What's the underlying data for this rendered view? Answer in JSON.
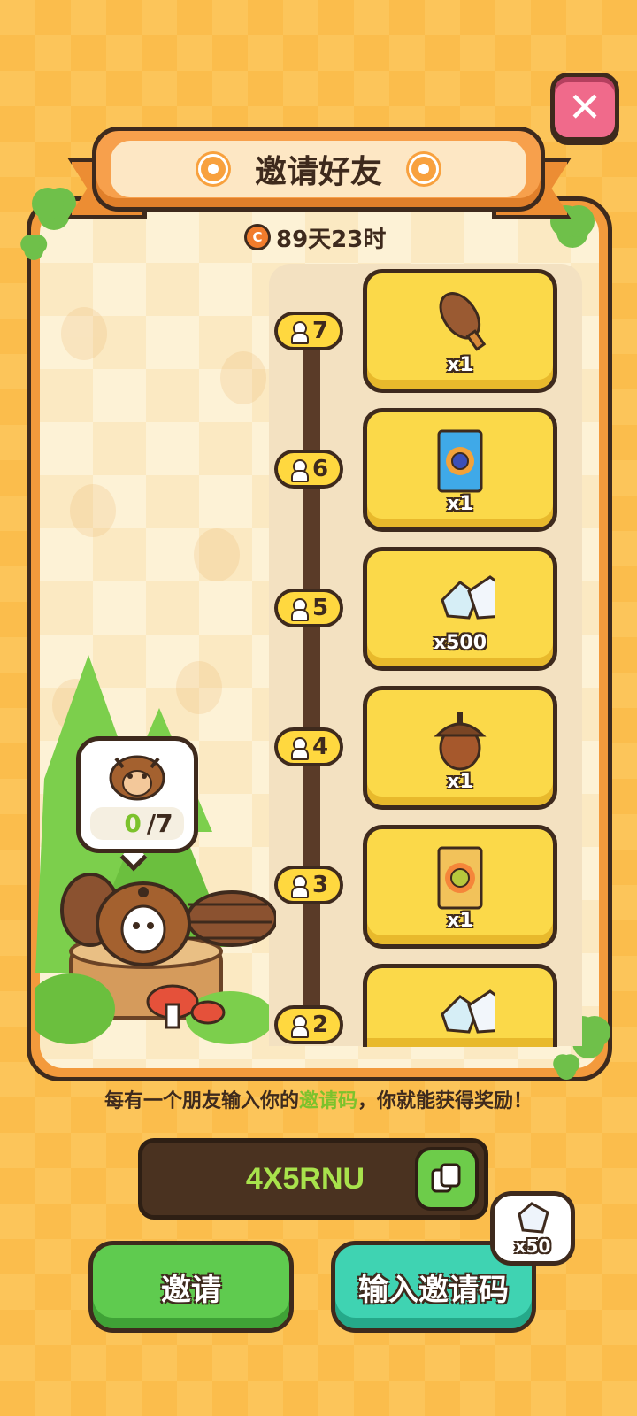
{
  "header": {
    "title": "邀请好友"
  },
  "timer": {
    "text": "89天23时",
    "icon": "countdown-icon"
  },
  "colors": {
    "accent_orange": "#f39a3c",
    "card_yellow": "#fbd949",
    "green": "#5fcb4f",
    "teal": "#3fd3b2",
    "outline": "#3e2a1d",
    "code_green": "#a8e24c"
  },
  "rewards": [
    {
      "level": "7",
      "item_icon": "pinecone-icon",
      "qty": "x1"
    },
    {
      "level": "6",
      "item_icon": "blueberry-pack-icon",
      "qty": "x1"
    },
    {
      "level": "5",
      "item_icon": "crystal-gems-icon",
      "qty": "x500"
    },
    {
      "level": "4",
      "item_icon": "acorn-icon",
      "qty": "x1"
    },
    {
      "level": "3",
      "item_icon": "durian-pack-icon",
      "qty": "x1"
    },
    {
      "level": "2",
      "item_icon": "crystal-gems-icon",
      "qty": ""
    }
  ],
  "progress": {
    "current": "0",
    "total": "/7"
  },
  "info": {
    "before": "每有一个朋友输入你的",
    "highlight": "邀请码",
    "after": "，你就能获得奖励！"
  },
  "invite_code": "4X5RNU",
  "buttons": {
    "invite": "邀请",
    "enter_code": "输入邀请码"
  },
  "bonus": {
    "qty": "x50",
    "icon": "crystal-icon"
  }
}
